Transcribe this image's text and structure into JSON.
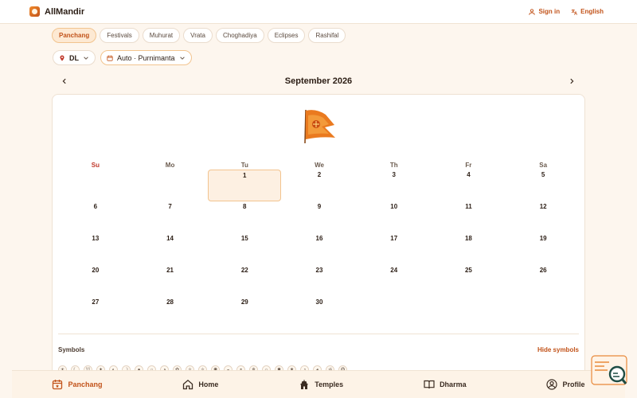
{
  "header": {
    "brand": "AllMandir",
    "signin": "Sign in",
    "language": "English"
  },
  "tabs": [
    {
      "label": "Panchang",
      "active": true
    },
    {
      "label": "Festivals"
    },
    {
      "label": "Muhurat"
    },
    {
      "label": "Vrata"
    },
    {
      "label": "Choghadiya"
    },
    {
      "label": "Eclipses"
    },
    {
      "label": "Rashifal"
    }
  ],
  "selectors": {
    "location": "DL",
    "mode": "Auto · Purnimanta"
  },
  "calendar": {
    "month_title": "September 2026",
    "weekdays": [
      "Su",
      "Mo",
      "Tu",
      "We",
      "Th",
      "Fr",
      "Sa"
    ],
    "leading_blanks": 2,
    "days": [
      "1",
      "2",
      "3",
      "4",
      "5",
      "6",
      "7",
      "8",
      "9",
      "10",
      "11",
      "12",
      "13",
      "14",
      "15",
      "16",
      "17",
      "18",
      "19",
      "20",
      "21",
      "22",
      "23",
      "24",
      "25",
      "26",
      "27",
      "28",
      "29",
      "30"
    ],
    "highlighted_day": "1"
  },
  "symbols": {
    "label": "Symbols",
    "toggle": "Hide symbols",
    "glyphs": [
      "☀",
      "☾",
      "11",
      "✦",
      "◐",
      "☽",
      "●",
      "○",
      "◑",
      "✿",
      "✧",
      "✧",
      "✺",
      "◒",
      "◓",
      "✵",
      "☼",
      "✹",
      "✷",
      "◔",
      "◕",
      "ॐ",
      "✪"
    ]
  },
  "bottom_nav": {
    "panchang": "Panchang",
    "home": "Home",
    "temples": "Temples",
    "dharma": "Dharma",
    "profile": "Profile"
  },
  "colors": {
    "accent": "#c2531a",
    "sunday": "#c0392b",
    "highlight_bg": "#fdf0e2"
  }
}
